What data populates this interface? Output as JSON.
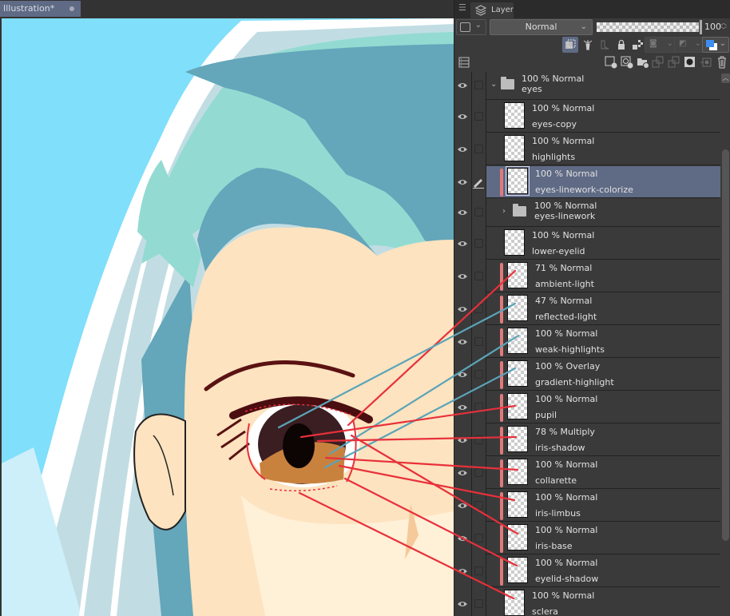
{
  "document": {
    "tab_title": "Illustration*"
  },
  "panel": {
    "tab_label": "Layer",
    "blend_mode": "Normal",
    "opacity_value": "100",
    "opacity_percent": 100
  },
  "layers": [
    {
      "opacity": "100 %",
      "mode": "Normal",
      "name": "eyes",
      "type": "folder",
      "expanded": true,
      "visible": true
    },
    {
      "opacity": "100 %",
      "mode": "Normal",
      "name": "eyes-copy",
      "type": "raster",
      "visible": true
    },
    {
      "opacity": "100 %",
      "mode": "Normal",
      "name": "highlights",
      "type": "raster",
      "visible": true
    },
    {
      "opacity": "100 %",
      "mode": "Normal",
      "name": "eyes-linework-colorize",
      "type": "raster",
      "clipped": true,
      "selected": true,
      "visible": true
    },
    {
      "opacity": "100 %",
      "mode": "Normal",
      "name": "eyes-linework",
      "type": "folder",
      "expanded": false,
      "visible": true
    },
    {
      "opacity": "100 %",
      "mode": "Normal",
      "name": "lower-eyelid",
      "type": "raster",
      "visible": true
    },
    {
      "opacity": "71 %",
      "mode": "Normal",
      "name": "ambient-light",
      "type": "raster",
      "clipped": true,
      "visible": true
    },
    {
      "opacity": "47 %",
      "mode": "Normal",
      "name": "reflected-light",
      "type": "raster",
      "clipped": true,
      "visible": true
    },
    {
      "opacity": "100 %",
      "mode": "Normal",
      "name": "weak-highlights",
      "type": "raster",
      "clipped": true,
      "visible": true
    },
    {
      "opacity": "100 %",
      "mode": "Overlay",
      "name": "gradient-highlight",
      "type": "raster",
      "clipped": true,
      "visible": true
    },
    {
      "opacity": "100 %",
      "mode": "Normal",
      "name": "pupil",
      "type": "raster",
      "clipped": true,
      "visible": true
    },
    {
      "opacity": "78 %",
      "mode": "Multiply",
      "name": "iris-shadow",
      "type": "raster",
      "clipped": true,
      "visible": true
    },
    {
      "opacity": "100 %",
      "mode": "Normal",
      "name": "collarette",
      "type": "raster",
      "clipped": true,
      "visible": true
    },
    {
      "opacity": "100 %",
      "mode": "Normal",
      "name": "iris-limbus",
      "type": "raster",
      "clipped": true,
      "visible": true
    },
    {
      "opacity": "100 %",
      "mode": "Normal",
      "name": "iris-base",
      "type": "raster",
      "clipped": true,
      "visible": true
    },
    {
      "opacity": "100 %",
      "mode": "Normal",
      "name": "eyelid-shadow",
      "type": "raster",
      "clipped": true,
      "visible": true
    },
    {
      "opacity": "100 %",
      "mode": "Normal",
      "name": "sclera",
      "type": "raster",
      "visible": true
    }
  ],
  "toolbar_icons": {
    "row2": [
      "clip-to-layer-below-icon",
      "reference-layer-icon",
      "draft-layer-icon",
      "lock-layer-icon",
      "lock-transparent-pixels-icon",
      "enable-mask-icon",
      "ruler-icon",
      "layer-color-icon"
    ],
    "row3": [
      "layer-property-icon",
      "new-raster-layer-icon",
      "new-vector-layer-icon",
      "new-folder-icon",
      "transfer-to-lower-layer-icon",
      "combine-with-layer-below-icon",
      "create-layer-mask-icon",
      "apply-mask-icon",
      "delete-layer-icon"
    ]
  },
  "colors": {
    "selected_layer": "#5f6a85",
    "clipping_bar": "#e07a7a",
    "annotation_red": "#e8303a",
    "annotation_blue": "#5ba4b8",
    "sky": "#80dffb"
  }
}
